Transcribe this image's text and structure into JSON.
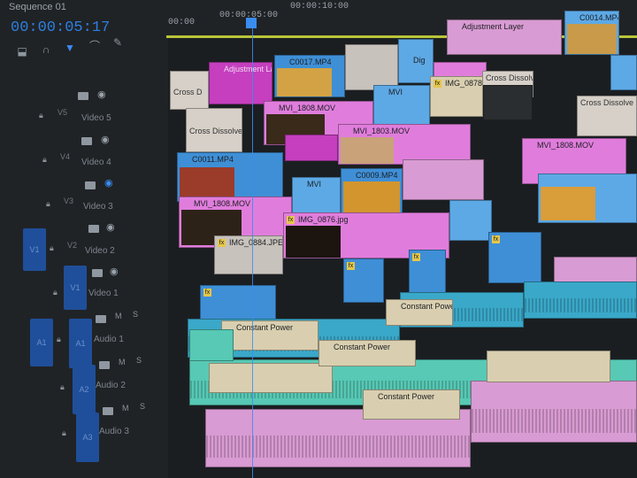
{
  "sequence_tab": "Sequence 01",
  "timecode": "00:00:05:17",
  "ruler": {
    "tc1": "00:00",
    "tc2": "00:00:05:00",
    "tc3": "00:00:10:00"
  },
  "toolbar_icons": [
    "snap-icon",
    "linked-icon",
    "marker-icon",
    "wrench-icon"
  ],
  "tracks": {
    "v5": "V5",
    "v4": "V4",
    "v3": "V3",
    "v2": "V2",
    "v1": "V1",
    "video5": "Video 5",
    "video4": "Video 4",
    "video3": "Video 3",
    "video2": "Video 2",
    "video1": "Video 1",
    "a1": "A1",
    "a2": "A2",
    "a3": "A3",
    "audio1": "Audio 1",
    "audio2": "Audio 2",
    "audio3": "Audio 3",
    "m": "M",
    "s": "S"
  },
  "clips": {
    "adjustment1": "Adjustment Layer",
    "adjustment2": "Adjustment Lay",
    "c0017": "C0017.MP4",
    "c0014": "C0014.MP4",
    "c0011": "C0011.MP4",
    "c0009": "C0009.MP4",
    "mvi1808a": "MVI_1808.MOV",
    "mvi1808b": "MVI_1808.MOV",
    "mvi1803": "MVI_1803.MOV",
    "mvi_short": "MVI",
    "img0878": "IMG_0878.jp",
    "img0884": "IMG_0884.JPE",
    "img0876": "IMG_0876.jpg",
    "cross_dissolve": "Cross Dissolve",
    "cross_short": "Cross D",
    "constant_power": "Constant Power",
    "dig": "Dig"
  }
}
